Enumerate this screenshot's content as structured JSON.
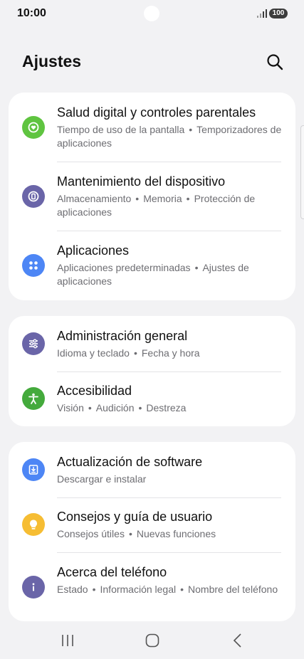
{
  "status": {
    "time": "10:00",
    "battery": "100"
  },
  "header": {
    "title": "Ajustes"
  },
  "icons": {
    "search": "search-icon",
    "digital_wellbeing": "heart-icon",
    "device_care": "device-care-icon",
    "apps": "apps-grid-icon",
    "general": "sliders-icon",
    "accessibility": "accessibility-icon",
    "software_update": "software-update-icon",
    "tips": "lightbulb-icon",
    "about": "info-icon"
  },
  "colors": {
    "digital_wellbeing": "#5fc440",
    "device_care": "#6a65a8",
    "apps": "#4d86f5",
    "general": "#6a65a8",
    "accessibility": "#44aa3c",
    "software_update": "#4d86f5",
    "tips": "#f6bd33",
    "about": "#6a65a8"
  },
  "groups": [
    {
      "items": [
        {
          "title": "Salud digital y controles parentales",
          "sub": [
            "Tiempo de uso de la pantalla",
            "Temporizadores de aplicaciones"
          ]
        },
        {
          "title": "Mantenimiento del dispositivo",
          "sub": [
            "Almacenamiento",
            "Memoria",
            "Protección de aplicaciones"
          ]
        },
        {
          "title": "Aplicaciones",
          "sub": [
            "Aplicaciones predeterminadas",
            "Ajustes de aplicaciones"
          ]
        }
      ]
    },
    {
      "items": [
        {
          "title": "Administración general",
          "sub": [
            "Idioma y teclado",
            "Fecha y hora"
          ]
        },
        {
          "title": "Accesibilidad",
          "sub": [
            "Visión",
            "Audición",
            "Destreza"
          ]
        }
      ]
    },
    {
      "items": [
        {
          "title": "Actualización de software",
          "sub": [
            "Descargar e instalar"
          ]
        },
        {
          "title": "Consejos y guía de usuario",
          "sub": [
            "Consejos útiles",
            "Nuevas funciones"
          ]
        },
        {
          "title": "Acerca del teléfono",
          "sub": [
            "Estado",
            "Información legal",
            "Nombre del teléfono"
          ]
        }
      ]
    }
  ],
  "separator": "•"
}
